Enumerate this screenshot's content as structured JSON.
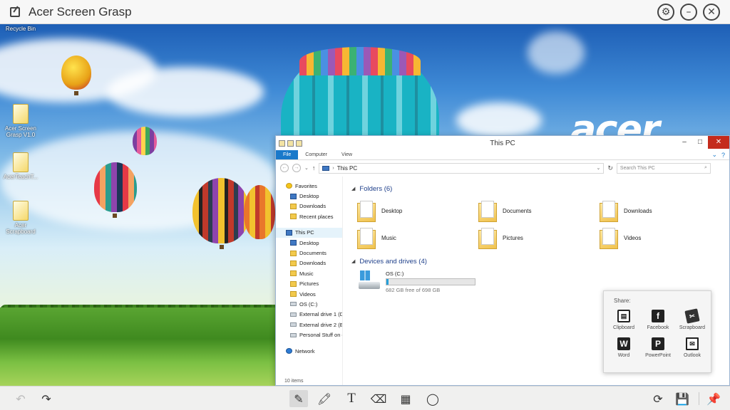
{
  "app": {
    "title": "Acer Screen Grasp"
  },
  "titlebar_controls": [
    {
      "name": "settings-button",
      "icon": "gear-icon",
      "glyph": "⚙"
    },
    {
      "name": "minimize-button",
      "icon": "minimize-icon",
      "glyph": "–"
    },
    {
      "name": "close-button",
      "icon": "close-icon",
      "glyph": "✕"
    }
  ],
  "desktop": {
    "brand_logo": "acer",
    "icons": [
      {
        "label": "Recycle Bin"
      },
      {
        "label": "Acer Screen Grasp V1.0"
      },
      {
        "label": "AcerTeachT..."
      },
      {
        "label": "Acer Scrapboard"
      }
    ]
  },
  "explorer": {
    "title": "This PC",
    "ribbon_tabs": [
      "File",
      "Computer",
      "View"
    ],
    "address": "This PC",
    "search_placeholder": "Search This PC",
    "nav": {
      "favorites_label": "Favorites",
      "favorites": [
        "Desktop",
        "Downloads",
        "Recent places"
      ],
      "thispc_label": "This PC",
      "thispc_items": [
        "Desktop",
        "Documents",
        "Downloads",
        "Music",
        "Pictures",
        "Videos",
        "OS (C:)",
        "External drive 1 (D:)",
        "External drive 2 (E:)",
        "Personal Stuff on ext"
      ],
      "network_label": "Network"
    },
    "folders_header": "Folders (6)",
    "folders": [
      "Desktop",
      "Documents",
      "Downloads",
      "Music",
      "Pictures",
      "Videos"
    ],
    "drives_header": "Devices and drives (4)",
    "drive": {
      "name": "OS (C:)",
      "free_text": "682 GB free of 698 GB",
      "used_fraction": 0.023
    },
    "status": "10 items"
  },
  "share": {
    "title": "Share:",
    "items": [
      {
        "label": "Clipboard",
        "icon": "clipboard-icon",
        "glyph": "▤"
      },
      {
        "label": "Facebook",
        "icon": "facebook-icon",
        "glyph": "f"
      },
      {
        "label": "Scrapboard",
        "icon": "scrapboard-icon",
        "glyph": "✂"
      },
      {
        "label": "Word",
        "icon": "word-icon",
        "glyph": "W"
      },
      {
        "label": "PowerPoint",
        "icon": "powerpoint-icon",
        "glyph": "P"
      },
      {
        "label": "Outlook",
        "icon": "outlook-icon",
        "glyph": "✉"
      }
    ]
  },
  "toolbar": {
    "undo": "↶",
    "redo": "↷",
    "pen": "✎",
    "highlighter": "🖍",
    "text": "T",
    "eraser": "⌫",
    "mosaic": "▦",
    "lasso": "◯",
    "share": "⟳",
    "save": "💾",
    "pin": "📌"
  }
}
